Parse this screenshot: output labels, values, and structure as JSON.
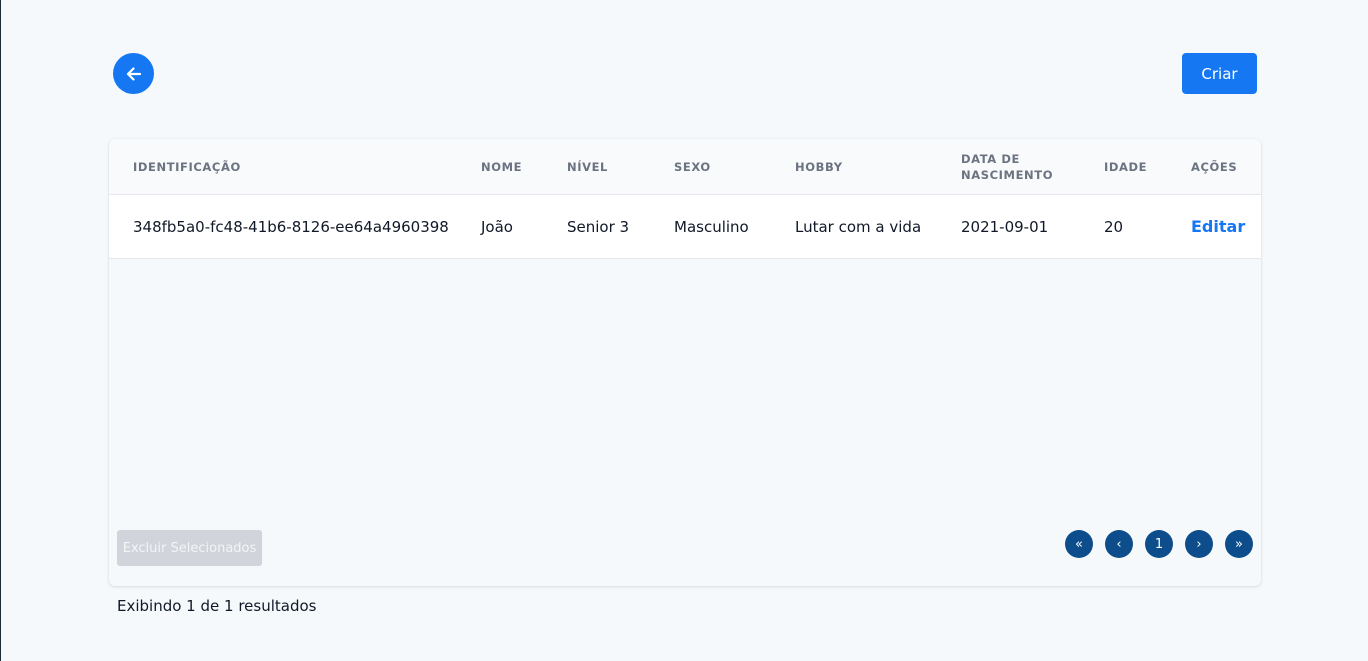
{
  "header": {
    "back_icon": "arrow-left-icon",
    "create_label": "Criar"
  },
  "table": {
    "columns": [
      "IDENTIFICAÇÃO",
      "NOME",
      "NÍVEL",
      "SEXO",
      "HOBBY",
      "DATA DE NASCIMENTO",
      "IDADE",
      "AÇÕES"
    ],
    "rows": [
      {
        "id": "348fb5a0-fc48-41b6-8126-ee64a4960398",
        "nome": "João",
        "nivel": "Senior 3",
        "sexo": "Masculino",
        "hobby": "Lutar com a vida",
        "data_nascimento": "2021-09-01",
        "idade": "20",
        "acao": "Editar"
      }
    ]
  },
  "footer": {
    "delete_label": "Excluir Selecionados",
    "pagination": {
      "first": "«",
      "prev": "‹",
      "current": "1",
      "next": "›",
      "last": "»"
    },
    "results_text": "Exibindo 1 de 1 resultados"
  },
  "colors": {
    "primary": "#1577f2",
    "pagination": "#0d4d8c",
    "disabled": "#d1d5db"
  }
}
